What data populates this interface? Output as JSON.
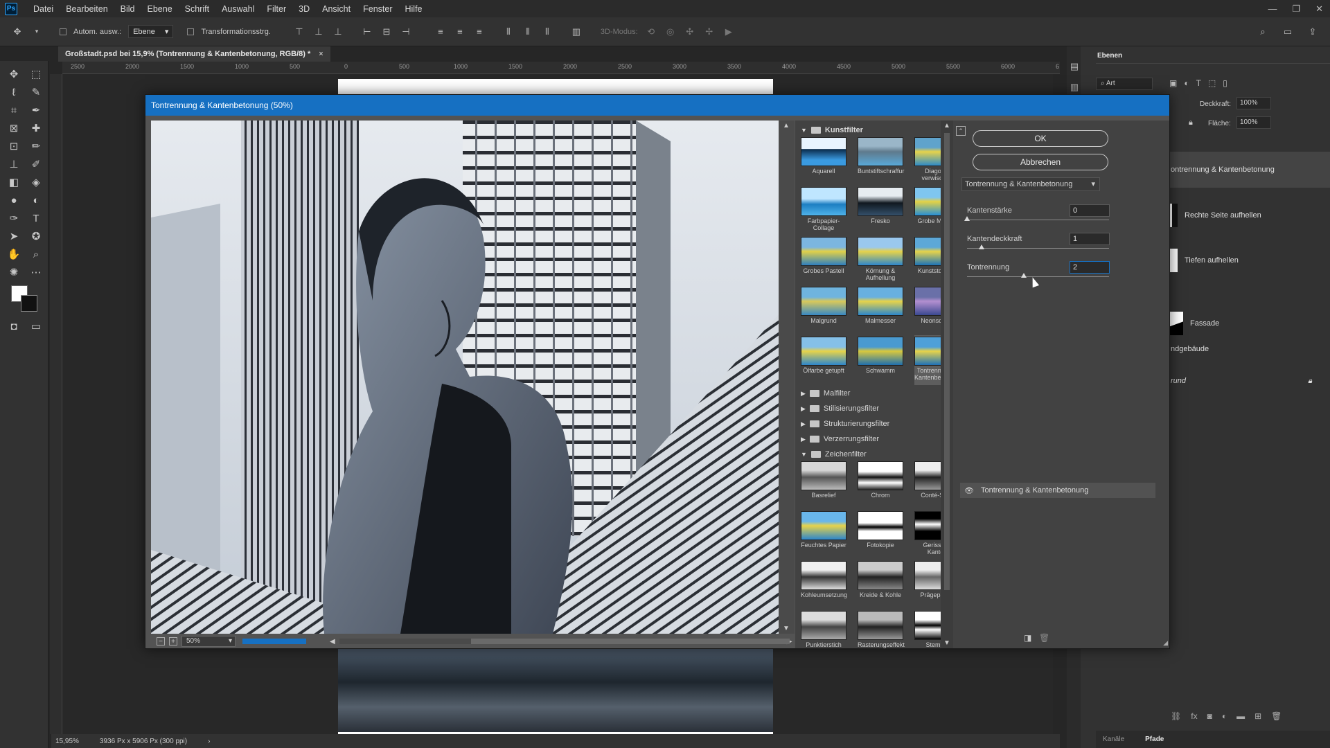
{
  "app": {
    "logo": "Ps"
  },
  "menu": [
    "Datei",
    "Bearbeiten",
    "Bild",
    "Ebene",
    "Schrift",
    "Auswahl",
    "Filter",
    "3D",
    "Ansicht",
    "Fenster",
    "Hilfe"
  ],
  "window_controls": [
    "—",
    "❐",
    "✕"
  ],
  "options_bar": {
    "auto_select_label": "Autom. ausw.:",
    "auto_select_value": "Ebene",
    "transform_label": "Transformationsstrg.",
    "mode3d_label": "3D-Modus:"
  },
  "document_tab": {
    "title": "Großstadt.psd bei 15,9% (Tontrennung & Kantenbetonung, RGB/8) *",
    "close": "×"
  },
  "ruler_h": [
    "2500",
    "2000",
    "1500",
    "1000",
    "500",
    "0",
    "500",
    "1000",
    "1500",
    "2000",
    "2500",
    "3000",
    "3500",
    "4000",
    "4500",
    "5000",
    "5500",
    "6000",
    "6"
  ],
  "status": {
    "zoom": "15,95%",
    "size": "3936 Px x 5906 Px (300 ppi)",
    "arrow": "›"
  },
  "layers_panel": {
    "tab": "Ebenen",
    "search_placeholder": "Art",
    "opacity_label": "Deckkraft:",
    "opacity_value": "100%",
    "fill_label": "Fläche:",
    "fill_value": "100%",
    "layers": [
      "ontrennung & Kantenbetonung",
      "Rechte Seite aufhellen",
      "Tiefen aufhellen",
      "Fassade",
      "ndgebäude",
      "rund"
    ],
    "bottom_tabs": [
      "Kanäle",
      "Pfade"
    ]
  },
  "dialog": {
    "title": "Tontrennung & Kantenbetonung (50%)",
    "zoom_value": "50%",
    "ok": "OK",
    "cancel": "Abbrechen",
    "filter_select": "Tontrennung & Kantenbetonung",
    "params": [
      {
        "label": "Kantenstärke",
        "value": "0",
        "level": 0.0
      },
      {
        "label": "Kantendeckkraft",
        "value": "1",
        "level": 0.1
      },
      {
        "label": "Tontrennung",
        "value": "2",
        "level": 0.4
      }
    ],
    "effect_layer": "Tontrennung & Kantenbetonung",
    "gallery": {
      "kunstfilter": "Kunstfilter",
      "kunst_items": [
        "Aquarell",
        "Buntstiftschraffur",
        "Diagonal verwischen",
        "Farbpapier-Collage",
        "Fresko",
        "Grobe Malerei",
        "Grobes Pastell",
        "Körnung & Aufhellung",
        "Kunststofffolie",
        "Malgrund",
        "Malmesser",
        "Neonschein",
        "Ölfarbe getupft",
        "Schwamm",
        "Tontrennung & Kantenbetonung"
      ],
      "collapsed": [
        "Malfilter",
        "Stilisierungsfilter",
        "Strukturierungsfilter",
        "Verzerrungsfilter"
      ],
      "zeichenfilter": "Zeichenfilter",
      "zeichen_items": [
        "Basrelief",
        "Chrom",
        "Conté-Stifte",
        "Feuchtes Papier",
        "Fotokopie",
        "Gerissene Kanten",
        "Kohleumsetzung",
        "Kreide & Kohle",
        "Prägepapier",
        "Punktierstich",
        "Rasterungseffekt",
        "Stempel"
      ]
    }
  },
  "colors": {
    "accent": "#1670c2",
    "panel": "#323232",
    "dialog": "#535353"
  }
}
